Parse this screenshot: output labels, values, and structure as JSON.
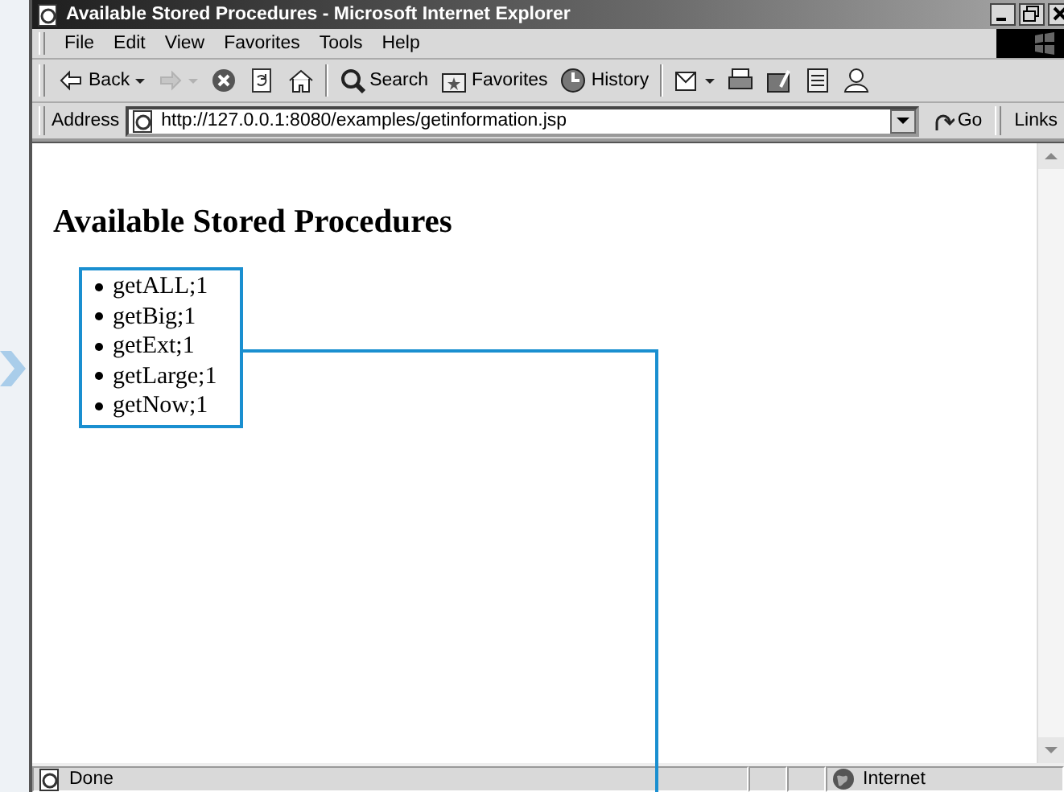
{
  "window": {
    "title": "Available Stored Procedures - Microsoft Internet Explorer"
  },
  "menu": [
    {
      "label": "File"
    },
    {
      "label": "Edit"
    },
    {
      "label": "View"
    },
    {
      "label": "Favorites"
    },
    {
      "label": "Tools"
    },
    {
      "label": "Help"
    }
  ],
  "toolbar": [
    {
      "kind": "button",
      "label": "Back",
      "dropdown": true,
      "disabled": false
    },
    {
      "kind": "button",
      "dropdown": true,
      "disabled": true
    },
    {
      "kind": "button",
      "dropdown": false,
      "disabled": false
    },
    {
      "kind": "button",
      "dropdown": false,
      "disabled": false
    },
    {
      "kind": "button",
      "dropdown": false,
      "disabled": false
    },
    {
      "kind": "separator"
    },
    {
      "kind": "button",
      "label": "Search",
      "dropdown": false,
      "disabled": false
    },
    {
      "kind": "button",
      "label": "Favorites",
      "dropdown": false,
      "disabled": false
    },
    {
      "kind": "button",
      "label": "History",
      "dropdown": false,
      "disabled": false
    },
    {
      "kind": "separator"
    },
    {
      "kind": "button",
      "dropdown": true,
      "disabled": false
    },
    {
      "kind": "button",
      "dropdown": false,
      "disabled": false
    },
    {
      "kind": "button",
      "dropdown": false,
      "disabled": false
    },
    {
      "kind": "button",
      "dropdown": false,
      "disabled": false
    },
    {
      "kind": "button",
      "dropdown": false,
      "disabled": false
    }
  ],
  "address": {
    "label": "Address",
    "value": "http://127.0.0.1:8080/examples/getinformation.jsp",
    "go": "Go",
    "links": "Links"
  },
  "page": {
    "heading": "Available Stored Procedures",
    "procedures": [
      "getALL;1",
      "getBig;1",
      "getExt;1",
      "getLarge;1",
      "getNow;1"
    ]
  },
  "status_bar": {
    "text": "Done",
    "zone": "Internet"
  }
}
